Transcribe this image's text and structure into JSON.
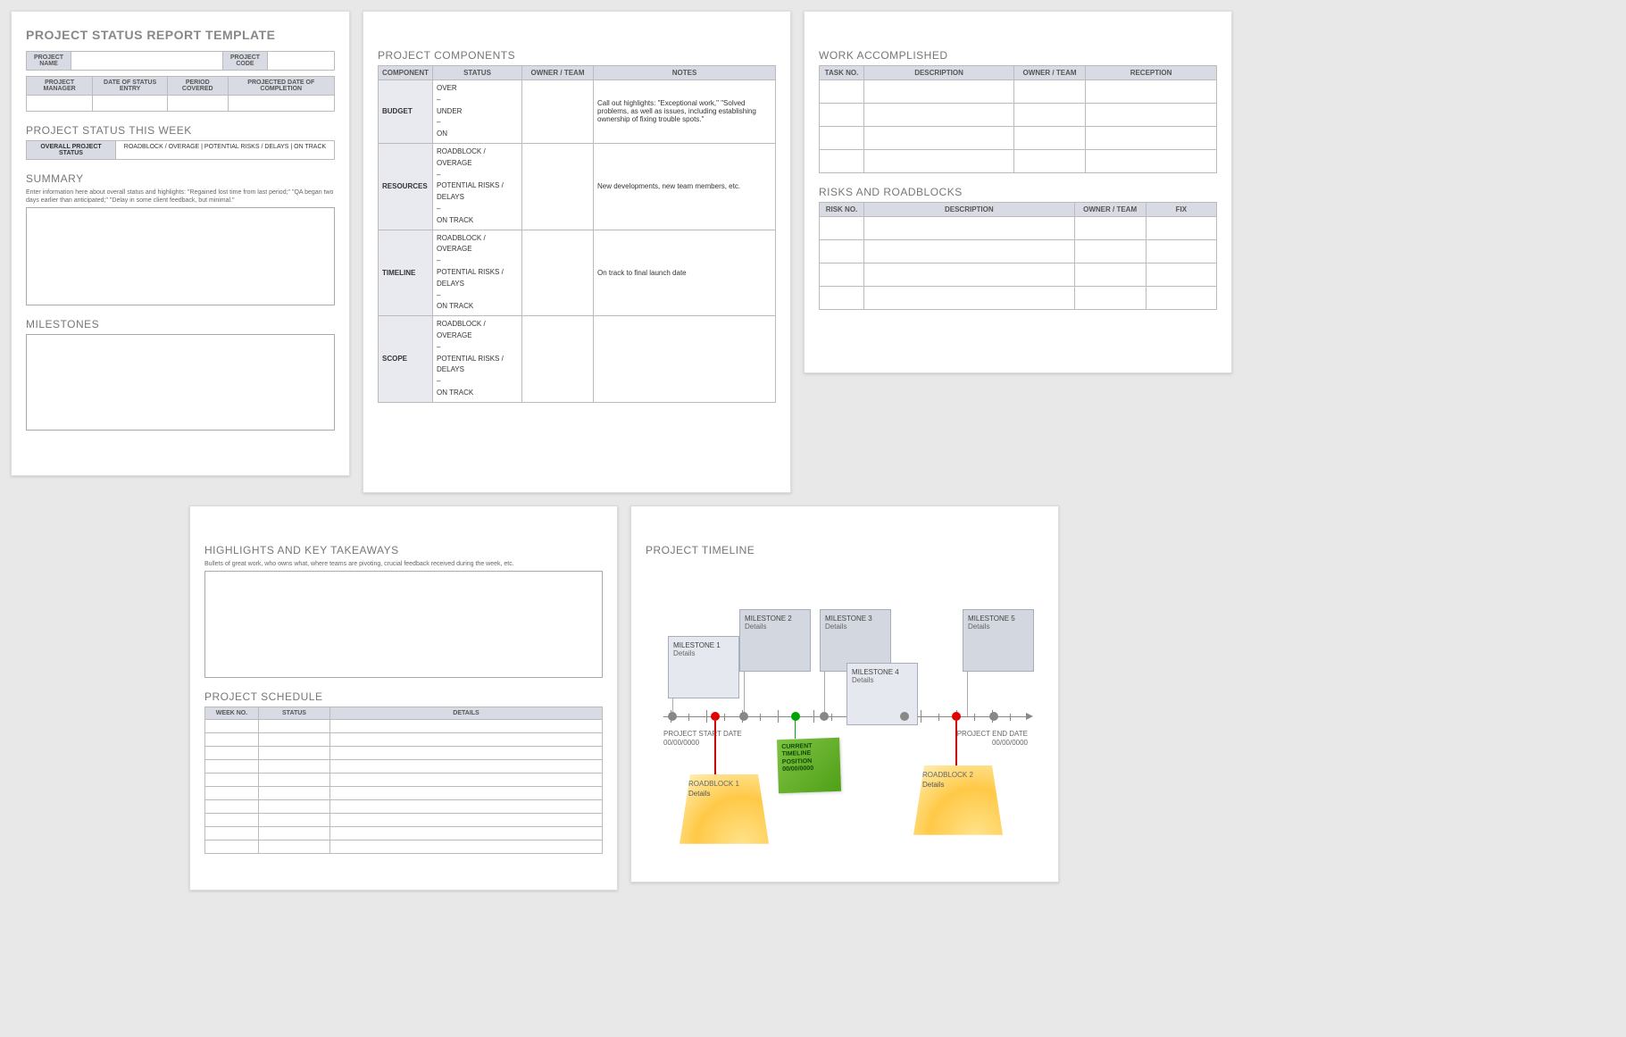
{
  "page1": {
    "title": "PROJECT STATUS REPORT TEMPLATE",
    "nameLabel": "PROJECT NAME",
    "codeLabel": "PROJECT CODE",
    "cols": [
      "PROJECT MANAGER",
      "DATE OF STATUS ENTRY",
      "PERIOD COVERED",
      "PROJECTED DATE OF COMPLETION"
    ],
    "statusWeek": "PROJECT STATUS THIS WEEK",
    "overall": "OVERALL PROJECT STATUS",
    "pillText": "ROADBLOCK / OVERAGE   |   POTENTIAL RISKS / DELAYS   |   ON TRACK",
    "summary": "SUMMARY",
    "summaryHint": "Enter information here about overall status and highlights: \"Regained lost time from last period;\" \"QA began two days earlier than anticipated;\" \"Delay in some client feedback, but minimal.\"",
    "milestones": "MILESTONES"
  },
  "page2": {
    "title": "PROJECT COMPONENTS",
    "headers": [
      "COMPONENT",
      "STATUS",
      "OWNER / TEAM",
      "NOTES"
    ],
    "rows": [
      {
        "c": "BUDGET",
        "s": "OVER\n–\nUNDER\n–\nON",
        "n": "Call out highlights: \"Exceptional work,\" \"Solved problems, as well as issues, including establishing ownership of fixing trouble spots.\""
      },
      {
        "c": "RESOURCES",
        "s": "ROADBLOCK / OVERAGE\n–\nPOTENTIAL RISKS / DELAYS\n–\nON TRACK",
        "n": "New developments, new team members, etc."
      },
      {
        "c": "TIMELINE",
        "s": "ROADBLOCK / OVERAGE\n–\nPOTENTIAL RISKS / DELAYS\n–\nON TRACK",
        "n": "On track to final launch date"
      },
      {
        "c": "SCOPE",
        "s": "ROADBLOCK / OVERAGE\n–\nPOTENTIAL RISKS / DELAYS\n–\nON TRACK",
        "n": ""
      }
    ]
  },
  "page3": {
    "waTitle": "WORK ACCOMPLISHED",
    "waHeaders": [
      "TASK NO.",
      "DESCRIPTION",
      "OWNER / TEAM",
      "RECEPTION"
    ],
    "rrTitle": "RISKS AND ROADBLOCKS",
    "rrHeaders": [
      "RISK NO.",
      "DESCRIPTION",
      "OWNER / TEAM",
      "FIX"
    ]
  },
  "page4": {
    "highlights": "HIGHLIGHTS AND KEY TAKEAWAYS",
    "highlightsHint": "Bullets of great work, who owns what, where teams are pivoting, crucial feedback received during the week, etc.",
    "schedule": "PROJECT SCHEDULE",
    "schHeaders": [
      "WEEK NO.",
      "STATUS",
      "DETAILS"
    ]
  },
  "page5": {
    "title": "PROJECT TIMELINE",
    "ms": [
      {
        "t": "MILESTONE 1",
        "d": "Details"
      },
      {
        "t": "MILESTONE 2",
        "d": "Details"
      },
      {
        "t": "MILESTONE 3",
        "d": "Details"
      },
      {
        "t": "MILESTONE 4",
        "d": "Details"
      },
      {
        "t": "MILESTONE 5",
        "d": "Details"
      }
    ],
    "start": "PROJECT START DATE\n00/00/0000",
    "end": "PROJECT END DATE\n00/00/0000",
    "current": "CURRENT TIMELINE POSITION 00/00/0000",
    "rb1": {
      "t": "ROADBLOCK 1",
      "d": "Details"
    },
    "rb2": {
      "t": "ROADBLOCK 2",
      "d": "Details"
    }
  }
}
